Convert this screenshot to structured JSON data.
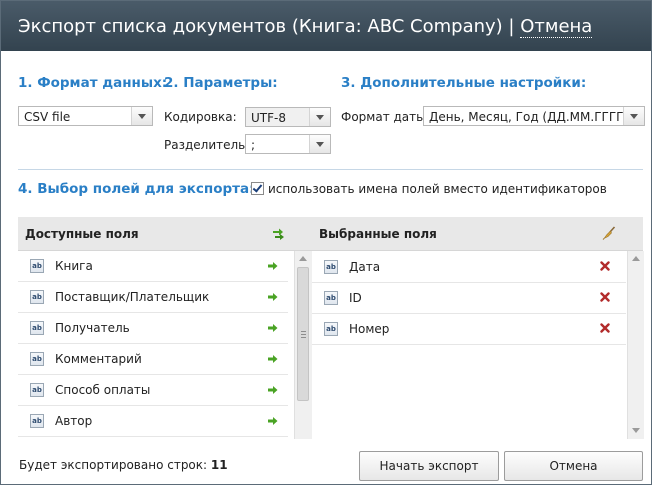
{
  "title": {
    "text": "Экспорт списка документов (Книга: ABC Company) | ",
    "cancel_link": "Отмена"
  },
  "sections": {
    "format": {
      "heading": "1. Формат данных:",
      "selected": "CSV file"
    },
    "params": {
      "heading": "2. Параметры:",
      "encoding_label": "Кодировка:",
      "encoding_value": "UTF-8",
      "separator_label": "Разделитель:",
      "separator_value": ";"
    },
    "extra": {
      "heading": "3. Дополнительные настройки:",
      "date_label": "Формат даты:",
      "date_value": "День, Месяц, Год (ДД.ММ.ГГГГ)"
    },
    "fields": {
      "heading": "4. Выбор полей для экспорта:",
      "checkbox_label": "использовать имена полей вместо идентификаторов",
      "checkbox_checked": true
    }
  },
  "available": {
    "header": "Доступные поля",
    "items": [
      {
        "label": "Книга"
      },
      {
        "label": "Поставщик/Плательщик"
      },
      {
        "label": "Получатель"
      },
      {
        "label": "Комментарий"
      },
      {
        "label": "Способ оплаты"
      },
      {
        "label": "Автор"
      }
    ]
  },
  "selected": {
    "header": "Выбранные поля",
    "items": [
      {
        "label": "Дата"
      },
      {
        "label": "ID"
      },
      {
        "label": "Номер"
      }
    ]
  },
  "footer": {
    "rows_label": "Будет экспортировано строк:",
    "rows_count": "11",
    "start_button": "Начать экспорт",
    "cancel_button": "Отмена"
  },
  "icons": {
    "field_type": "ab",
    "add": "green-arrow-right-icon",
    "remove": "red-x-icon",
    "add_all": "double-green-arrow-icon",
    "clear": "broom-icon"
  },
  "colors": {
    "titlebar": "#3b4b58",
    "accent": "#2a7fc6",
    "add_green": "#4aa324",
    "remove_red": "#b22b2b"
  }
}
